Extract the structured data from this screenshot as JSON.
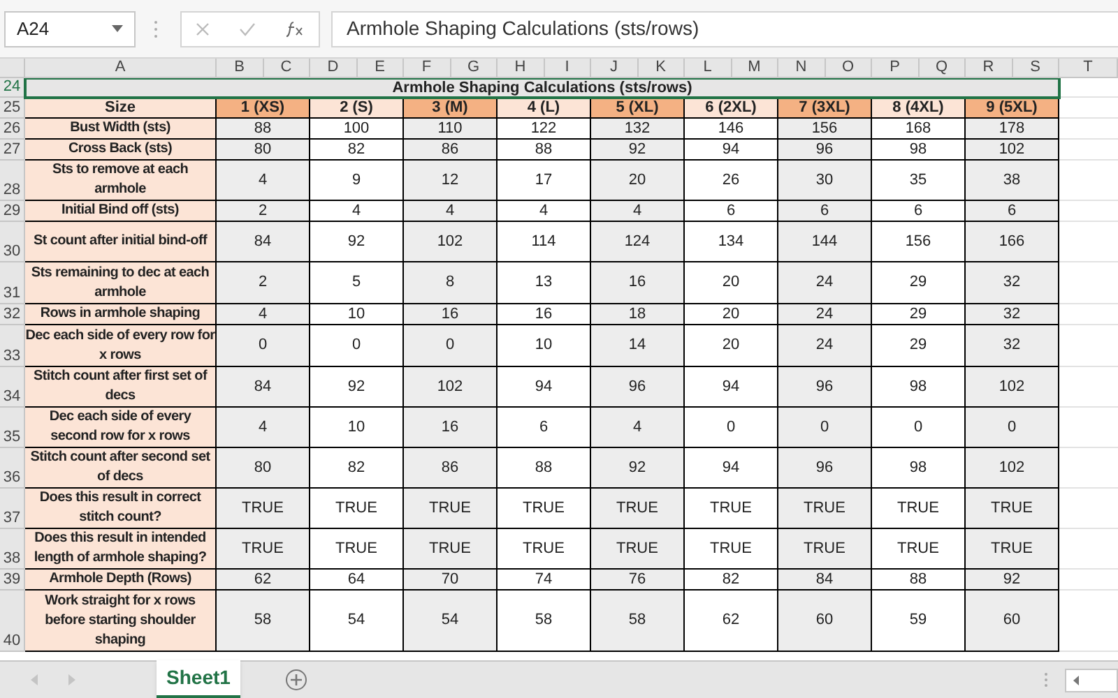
{
  "formula_bar": {
    "name_box": "A24",
    "formula": "Armhole Shaping Calculations (sts/rows)"
  },
  "column_headers": [
    "A",
    "B",
    "C",
    "D",
    "E",
    "F",
    "G",
    "H",
    "I",
    "J",
    "K",
    "L",
    "M",
    "N",
    "O",
    "P",
    "Q",
    "R",
    "S",
    "T"
  ],
  "title_row": {
    "row": "24",
    "text": "Armhole Shaping Calculations (sts/rows)",
    "selected": true
  },
  "header_row": {
    "row": "25",
    "label": "Size",
    "sizes": [
      "1 (XS)",
      "2 (S)",
      "3 (M)",
      "4 (L)",
      "5 (XL)",
      "6 (2XL)",
      "7 (3XL)",
      "8 (4XL)",
      "9 (5XL)"
    ]
  },
  "rows": [
    {
      "row": "26",
      "label": "Bust Width (sts)",
      "values": [
        "88",
        "100",
        "110",
        "122",
        "132",
        "146",
        "156",
        "168",
        "178"
      ]
    },
    {
      "row": "27",
      "label": "Cross Back (sts)",
      "values": [
        "80",
        "82",
        "86",
        "88",
        "92",
        "94",
        "96",
        "98",
        "102"
      ]
    },
    {
      "row": "28",
      "label": "Sts to remove at each armhole",
      "values": [
        "4",
        "9",
        "12",
        "17",
        "20",
        "26",
        "30",
        "35",
        "38"
      ]
    },
    {
      "row": "29",
      "label": "Initial Bind off (sts)",
      "values": [
        "2",
        "4",
        "4",
        "4",
        "4",
        "6",
        "6",
        "6",
        "6"
      ]
    },
    {
      "row": "30",
      "label": "St count after initial bind-off",
      "values": [
        "84",
        "92",
        "102",
        "114",
        "124",
        "134",
        "144",
        "156",
        "166"
      ]
    },
    {
      "row": "31",
      "label": "Sts remaining to dec at each armhole",
      "values": [
        "2",
        "5",
        "8",
        "13",
        "16",
        "20",
        "24",
        "29",
        "32"
      ]
    },
    {
      "row": "32",
      "label": "Rows in armhole shaping",
      "values": [
        "4",
        "10",
        "16",
        "16",
        "18",
        "20",
        "24",
        "29",
        "32"
      ]
    },
    {
      "row": "33",
      "label": "Dec each side of every row for x rows",
      "values": [
        "0",
        "0",
        "0",
        "10",
        "14",
        "20",
        "24",
        "29",
        "32"
      ]
    },
    {
      "row": "34",
      "label": "Stitch count after first set of decs",
      "values": [
        "84",
        "92",
        "102",
        "94",
        "96",
        "94",
        "96",
        "98",
        "102"
      ]
    },
    {
      "row": "35",
      "label": "Dec each side of every second row for x rows",
      "values": [
        "4",
        "10",
        "16",
        "6",
        "4",
        "0",
        "0",
        "0",
        "0"
      ]
    },
    {
      "row": "36",
      "label": "Stitch count after second set of decs",
      "values": [
        "80",
        "82",
        "86",
        "88",
        "92",
        "94",
        "96",
        "98",
        "102"
      ]
    },
    {
      "row": "37",
      "label": "Does this result in correct stitch count?",
      "values": [
        "TRUE",
        "TRUE",
        "TRUE",
        "TRUE",
        "TRUE",
        "TRUE",
        "TRUE",
        "TRUE",
        "TRUE"
      ]
    },
    {
      "row": "38",
      "label": "Does this result in intended length of armhole shaping?",
      "values": [
        "TRUE",
        "TRUE",
        "TRUE",
        "TRUE",
        "TRUE",
        "TRUE",
        "TRUE",
        "TRUE",
        "TRUE"
      ]
    },
    {
      "row": "39",
      "label": "Armhole Depth (Rows)",
      "values": [
        "62",
        "64",
        "70",
        "74",
        "76",
        "82",
        "84",
        "88",
        "92"
      ]
    },
    {
      "row": "40",
      "label": "Work straight for x rows before starting shoulder shaping",
      "values": [
        "58",
        "54",
        "54",
        "58",
        "58",
        "62",
        "60",
        "59",
        "60"
      ]
    }
  ],
  "sheet_tabs": [
    {
      "label": "Sheet1",
      "selected": true
    }
  ]
}
